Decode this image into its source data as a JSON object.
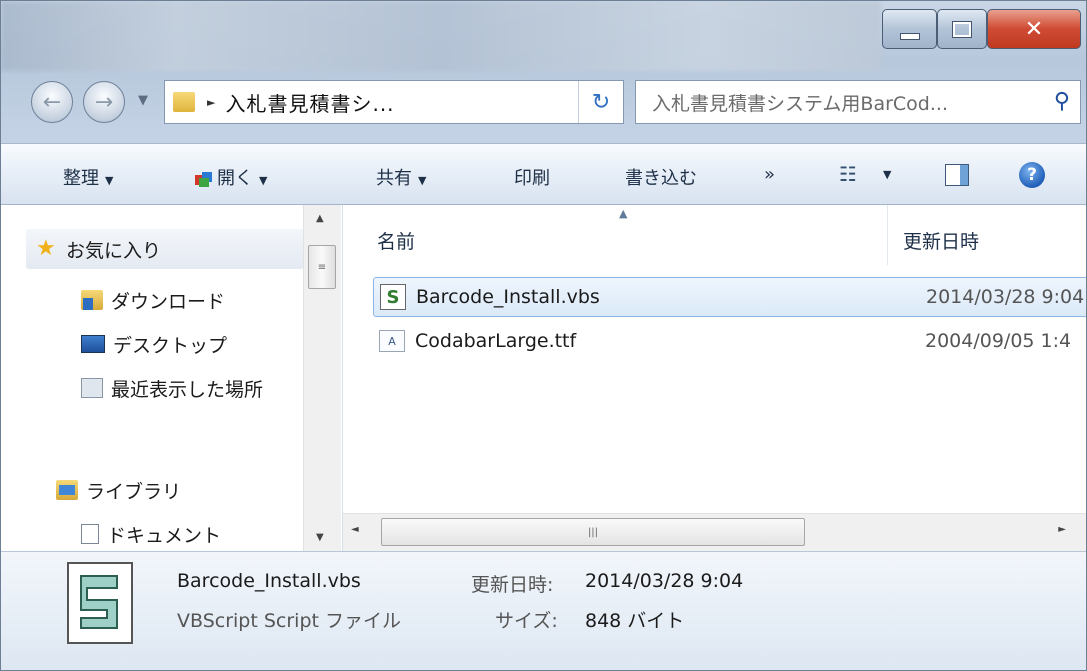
{
  "address": {
    "path": "入札書見積書シ..."
  },
  "search": {
    "placeholder": "入札書見積書システム用BarCod..."
  },
  "toolbar": {
    "organize": "整理",
    "open": "開く",
    "share": "共有",
    "print": "印刷",
    "burn": "書き込む",
    "more": "»"
  },
  "sidebar": {
    "favorites": "お気に入り",
    "items": [
      {
        "label": "ダウンロード"
      },
      {
        "label": "デスクトップ"
      },
      {
        "label": "最近表示した場所"
      }
    ],
    "library": "ライブラリ",
    "library_items": [
      {
        "label": "ドキュメント"
      }
    ]
  },
  "columns": {
    "name": "名前",
    "date": "更新日時"
  },
  "files": [
    {
      "name": "Barcode_Install.vbs",
      "date": "2014/03/28 9:04"
    },
    {
      "name": "CodabarLarge.ttf",
      "date": "2004/09/05 1:4"
    }
  ],
  "details": {
    "filename": "Barcode_Install.vbs",
    "modified_label": "更新日時:",
    "modified_value": "2014/03/28 9:04",
    "type": "VBScript Script ファイル",
    "size_label": "サイズ:",
    "size_value": "848 バイト"
  }
}
